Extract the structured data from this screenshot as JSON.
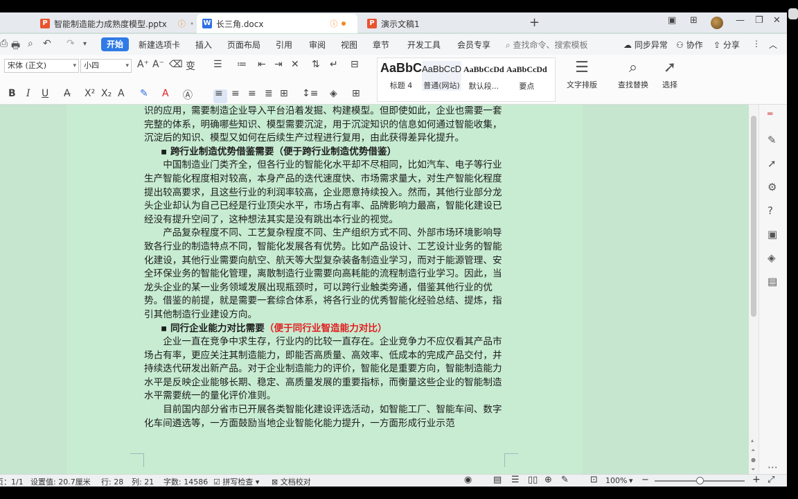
{
  "tabs": [
    {
      "label": "智能制造能力成熟度模型.pptx",
      "type": "P"
    },
    {
      "label": "长三角.docx",
      "type": "W"
    },
    {
      "label": "演示文稿1",
      "type": "P"
    }
  ],
  "menu": {
    "start": "开始",
    "items": [
      "新建选项卡",
      "插入",
      "页面布局",
      "引用",
      "审阅",
      "视图",
      "章节",
      "开发工具",
      "会员专享"
    ],
    "search_placeholder": "查找命令、搜索模板",
    "sync": "同步异常",
    "collab": "协作",
    "share": "分享"
  },
  "ribbon": {
    "font_name": "宋体 (正文)",
    "font_size": "小四",
    "styles": [
      {
        "sample": "AaBbC",
        "label": "标题 4"
      },
      {
        "sample": "AaBbCcD",
        "label": "普通(网站)"
      },
      {
        "sample": "AaBbCcDd",
        "label": "默认段..."
      },
      {
        "sample": "AaBbCcDd",
        "label": "要点"
      }
    ],
    "text_layout": "文字排版",
    "find_replace": "查找替换",
    "select": "选择"
  },
  "document": {
    "paragraphs": [
      {
        "kind": "text",
        "text": "识的应用，需要制造企业导入平台沿着发掘、构建模型。但即使如此，企业也需要一套完整的体系，明确哪些知识、模型需要沉淀，用于沉淀知识的信息如何通过智能收集，沉淀后的知识、模型又如何在后续生产过程进行复用，由此获得差异化提升。",
        "indent": false
      },
      {
        "kind": "bullet",
        "text": "跨行业制造优势借鉴需要（便于跨行业制造优势借鉴）"
      },
      {
        "kind": "text",
        "text": "中国制造业门类齐全，但各行业的智能化水平却不尽相同，比如汽车、电子等行业生产智能化程度相对较高，本身产品的迭代速度快、市场需求量大，对生产智能化程度提出较高要求，且这些行业的利润率较高，企业愿意持续投入。然而，其他行业部分龙头企业却认为自己已经是行业顶尖水平，市场占有率、品牌影响力最高，智能化建设已经没有提升空间了，这种想法其实是没有跳出本行业的视觉。",
        "indent": true
      },
      {
        "kind": "text",
        "text": "产品复杂程度不同、工艺复杂程度不同、生产组织方式不同、外部市场环境影响导致各行业的制造特点不同，智能化发展各有优势。比如产品设计、工艺设计业务的智能化建设，其他行业需要向航空、航天等大型复杂装备制造业学习，而对于能源管理、安全环保业务的智能化管理，离散制造行业需要向高耗能的流程制造行业学习。因此，当龙头企业的某一业务领域发展出现瓶颈时，可以跨行业触类旁通，借鉴其他行业的优势。借鉴的前提，就是需要一套综合体系，将各行业的优秀智能化经验总结、提炼，指引其他制造行业建设方向。",
        "indent": true
      },
      {
        "kind": "bullet_red",
        "text": "同行企业能力对比需要",
        "red": "（便于同行业智造能力对比）"
      },
      {
        "kind": "text",
        "text": "企业一直在竞争中求生存，行业内的比较一直存在。企业竞争力不应仅看其产品市场占有率，更应关注其制造能力，即能否高质量、高效率、低成本的完成产品交付，并持续迭代研发出新产品。对于企业制造能力的评价，智能化是重要方向，智能制造能力水平是反映企业能够长期、稳定、高质量发展的重要指标，而衡量这些企业的智能制造水平需要统一的量化评价准则。",
        "indent": true
      },
      {
        "kind": "text",
        "text": "目前国内部分省市已开展各类智能化建设评选活动，如智能工厂、智能车间、数字化车间遴选等，一方面鼓励当地企业智能化能力提升，一方面形成行业示范",
        "indent": true
      }
    ]
  },
  "status": {
    "page": "页：1/1",
    "setting": "设置值: 20.7厘米",
    "row": "行: 28",
    "col": "列: 21",
    "words": "字数: 14586",
    "spell": "拼写检查",
    "proof": "文档校对",
    "zoom": "100%"
  }
}
